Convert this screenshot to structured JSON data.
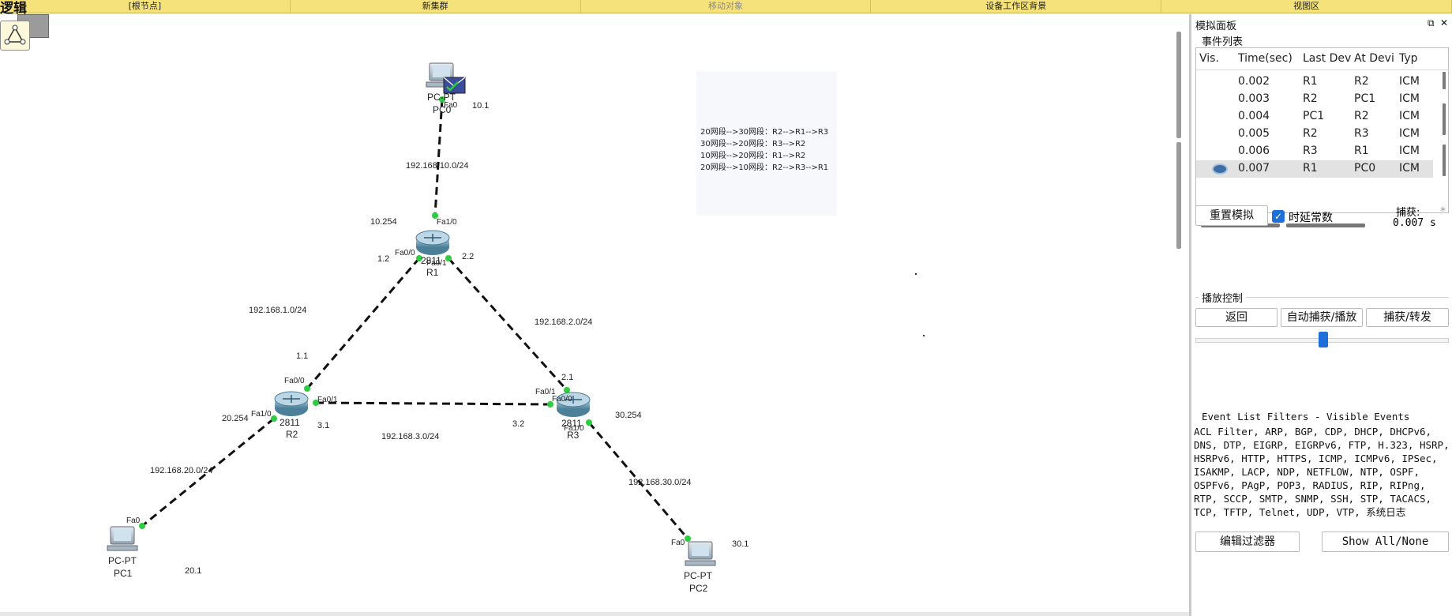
{
  "topbar": {
    "root": "[根节点]",
    "new_cluster": "新集群",
    "move_object": "移动对象",
    "workspace_bg": "设备工作区背景",
    "viewport": "视图区"
  },
  "logic_label": "逻辑",
  "topology": {
    "devices": {
      "pc0": {
        "type": "PC-PT",
        "name": "PC0",
        "ip": "10.1",
        "port": "Fa0"
      },
      "pc1": {
        "type": "PC-PT",
        "name": "PC1",
        "ip": "20.1",
        "port": "Fa0"
      },
      "pc2": {
        "type": "PC-PT",
        "name": "PC2",
        "ip": "30.1",
        "port": "Fa0"
      },
      "r1": {
        "model": "2811",
        "name": "R1",
        "p1": "Fa1/0",
        "p2": "Fa0/0",
        "p3": "Fa0/1",
        "ip_left": "1.2",
        "ip_right": "2.2",
        "ip_top": "10.254"
      },
      "r2": {
        "model": "2811",
        "name": "R2",
        "p1": "Fa0/0",
        "p2": "Fa0/1",
        "p3": "Fa1/0",
        "ip_top": "1.1",
        "ip_right": "3.1",
        "ip_left": "20.254"
      },
      "r3": {
        "model": "2811",
        "name": "R3",
        "p1": "Fa0/1",
        "p2": "Fa0/0",
        "p3": "Fa1/0",
        "ip_top": "2.1",
        "ip_left": "3.2",
        "ip_right": "30.254"
      }
    },
    "networks": {
      "n10": "192.168.10.0/24",
      "n1": "192.168.1.0/24",
      "n2": "192.168.2.0/24",
      "n3": "192.168.3.0/24",
      "n20": "192.168.20.0/24",
      "n30": "192.168.30.0/24"
    },
    "note_lines": [
      "20网段-->30网段：R2-->R1-->R3",
      "30网段-->20网段：R3-->R2",
      "10网段-->20网段：R1-->R2",
      "20网段-->10网段：R2-->R3-->R1"
    ]
  },
  "panel": {
    "title": "模拟面板",
    "event_list_label": "事件列表",
    "columns": {
      "vis": "Vis.",
      "time": "Time(sec)",
      "last": "Last Dev",
      "at": "At Devi",
      "type": "Typ"
    },
    "events": [
      {
        "time": "0.002",
        "last": "R1",
        "at": "R2",
        "type": "ICM"
      },
      {
        "time": "0.003",
        "last": "R2",
        "at": "PC1",
        "type": "ICM"
      },
      {
        "time": "0.004",
        "last": "PC1",
        "at": "R2",
        "type": "ICM"
      },
      {
        "time": "0.005",
        "last": "R2",
        "at": "R3",
        "type": "ICM"
      },
      {
        "time": "0.006",
        "last": "R3",
        "at": "R1",
        "type": "ICM"
      },
      {
        "time": "0.007",
        "last": "R1",
        "at": "PC0",
        "type": "ICM"
      }
    ],
    "reset_btn": "重置模拟",
    "const_delay": "时延常数",
    "capture_label": "捕获:",
    "capture_time": "0.007 s",
    "playback_label": "播放控制",
    "back_btn": "返回",
    "auto_btn": "自动捕获/播放",
    "capture_fwd_btn": "捕获/转发",
    "filter_title": "Event List Filters - Visible Events",
    "filter_text": "ACL Filter, ARP, BGP, CDP, DHCP, DHCPv6, DNS, DTP, EIGRP, EIGRPv6, FTP, H.323, HSRP, HSRPv6, HTTP, HTTPS, ICMP, ICMPv6, IPSec, ISAKMP, LACP, NDP, NETFLOW, NTP, OSPF, OSPFv6, PAgP, POP3, RADIUS, RIP, RIPng, RTP, SCCP, SMTP, SNMP, SSH, STP, TACACS, TCP, TFTP, Telnet, UDP, VTP, 系统日志",
    "edit_filter_btn": "编辑过滤器",
    "show_all_btn": "Show All/None"
  }
}
